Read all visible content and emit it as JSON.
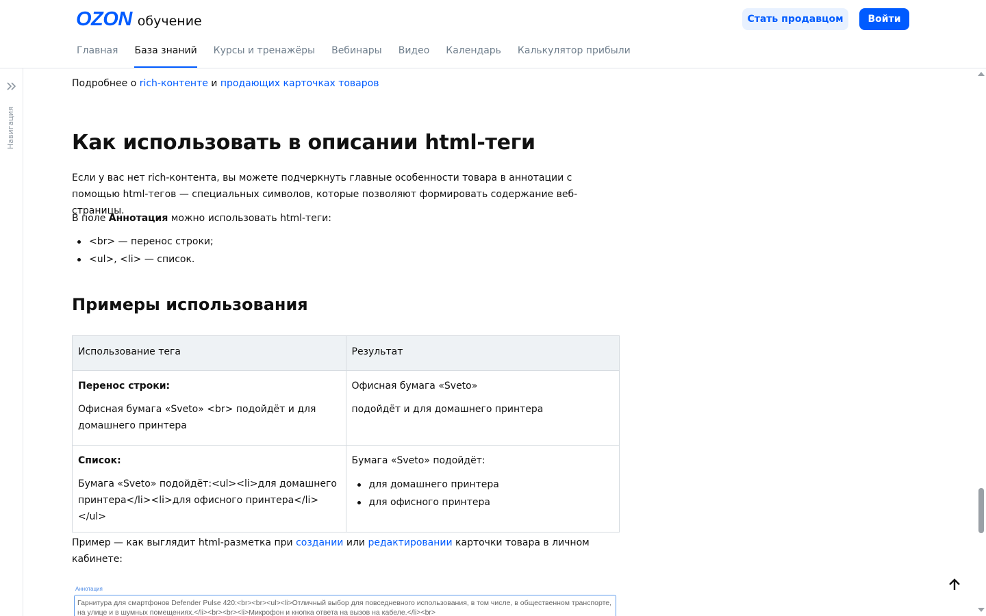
{
  "header": {
    "logo_mark": "OZON",
    "logo_sub": "обучение",
    "seller_button": "Стать продавцом",
    "login_button": "Войти",
    "nav": [
      {
        "label": "Главная",
        "active": false
      },
      {
        "label": "База знаний",
        "active": true
      },
      {
        "label": "Курсы и тренажёры",
        "active": false
      },
      {
        "label": "Вебинары",
        "active": false
      },
      {
        "label": "Видео",
        "active": false
      },
      {
        "label": "Календарь",
        "active": false
      },
      {
        "label": "Калькулятор прибыли",
        "active": false
      }
    ]
  },
  "sidenav": {
    "label": "Навигация",
    "icon": "double-chevron-right-icon"
  },
  "content": {
    "intro": {
      "prefix": "Подробнее о ",
      "link1": "rich-контенте",
      "middle": " и ",
      "link2": "продающих карточках товаров"
    },
    "h1": "Как использовать в описании html-теги",
    "p1": "Если у вас нет rich-контента, вы можете подчеркнуть главные особенности товара в аннотации с помощью html-тегов — специальных символов, которые позволяют формировать содержание веб-страницы.",
    "p2": {
      "prefix": "В поле ",
      "bold": "Аннотация",
      "suffix": " можно использовать html-теги:"
    },
    "bullets": [
      "<br> — перенос строки;",
      "<ul>, <li> — список."
    ],
    "h2": "Примеры использования",
    "table": {
      "headers": [
        "Использование тега",
        "Результат"
      ],
      "row1": {
        "title": "Перенос строки:",
        "code": "Офисная бумага «Sveto» <br> подойдёт и для домашнего принтера",
        "result_line1": "Офисная бумага «Sveto»",
        "result_line2": "подойдёт и для домашнего принтера"
      },
      "row2": {
        "title": "Список:",
        "code": "Бумага «Sveto» подойдёт:<ul><li>для домашнего принтера</li><li>для офисного принтера</li></ul>",
        "result_intro": "Бумага «Sveto» подойдёт:",
        "result_items": [
          "для домашнего принтера",
          "для офисного принтера"
        ]
      }
    },
    "p3": {
      "prefix": "Пример — как выглядит html-разметка при ",
      "link1": "создании",
      "middle": " или ",
      "link2": "редактировании",
      "suffix": " карточки товара в личном кабинете:"
    },
    "annotation": {
      "label": "Аннотация",
      "text": "Гарнитура для смартфонов Defender Pulse 420:<br><br><ul><li>Отличный выбор для повседневного использования, в том числе, в общественном транспорте, на улице и в шумных помещениях.</li><br><br><li>Микрофон и кнопка ответа на вызов на кабеле.</li><br>"
    }
  },
  "colors": {
    "brand": "#005bff",
    "seller_button_bg": "#e8f1ff",
    "table_header_bg": "#eef2f5",
    "muted_nav": "#707f8d"
  }
}
